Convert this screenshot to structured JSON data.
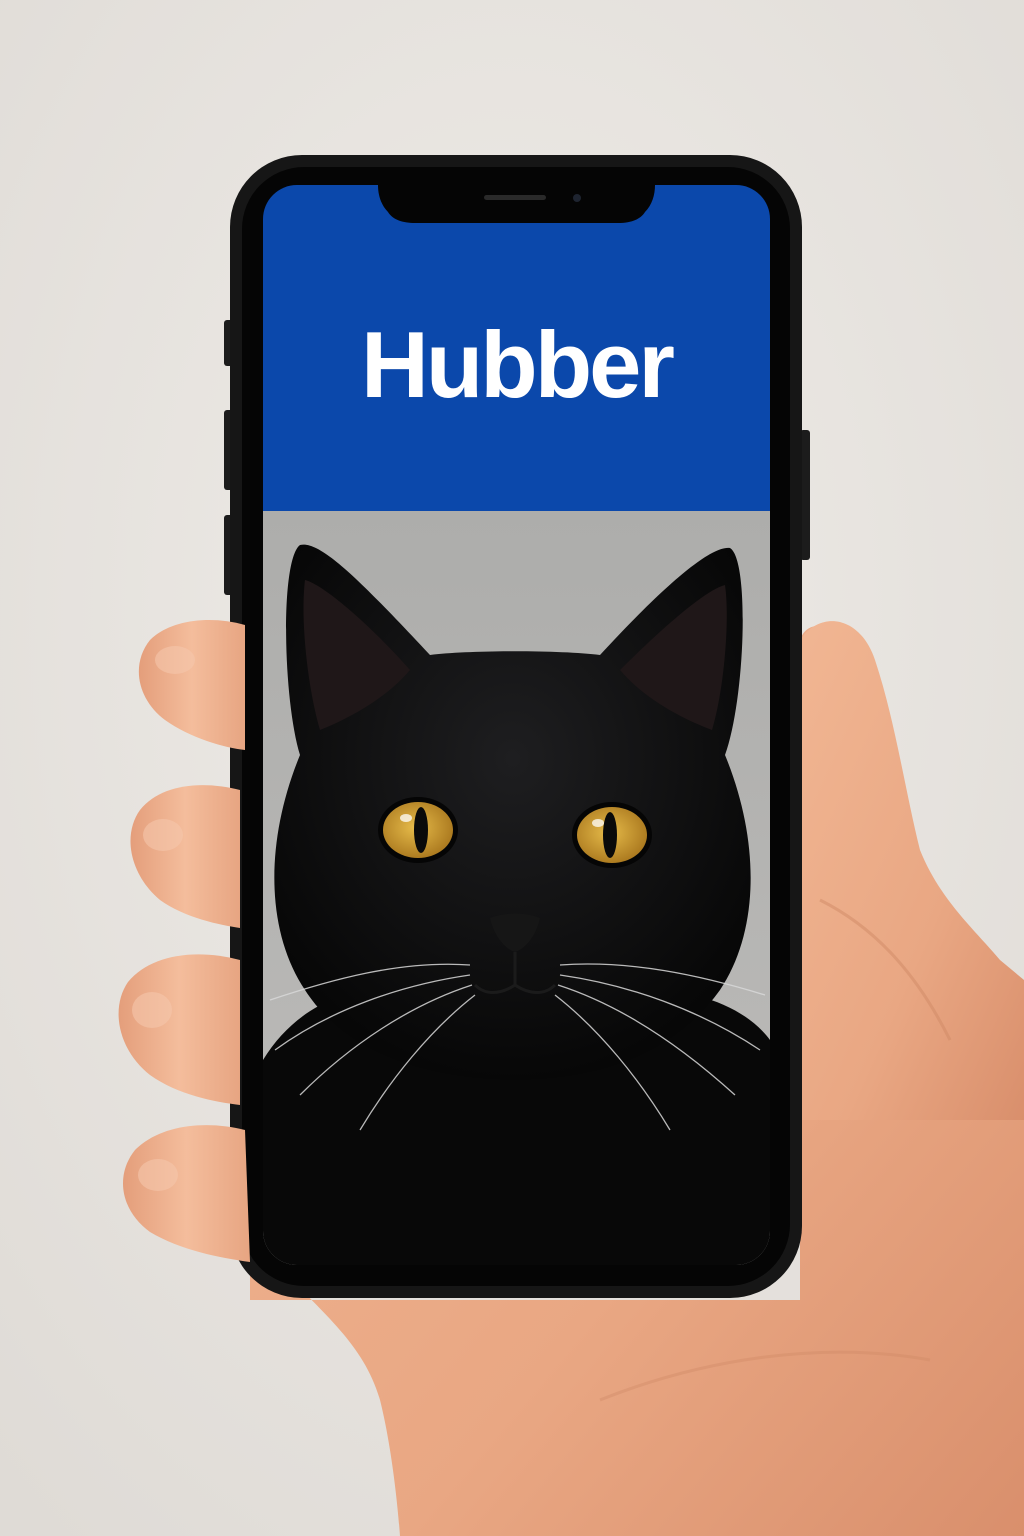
{
  "app": {
    "title": "Hubber"
  },
  "colors": {
    "background": "#e9e6e2",
    "brand_blue": "#0b48ab",
    "photo_backdrop": "#b4b3b1",
    "phone_frame": "#161616",
    "cat_fur": "#0c0c0d",
    "cat_eye": "#c89a2c"
  },
  "content": {
    "photo_subject": "black cat"
  }
}
